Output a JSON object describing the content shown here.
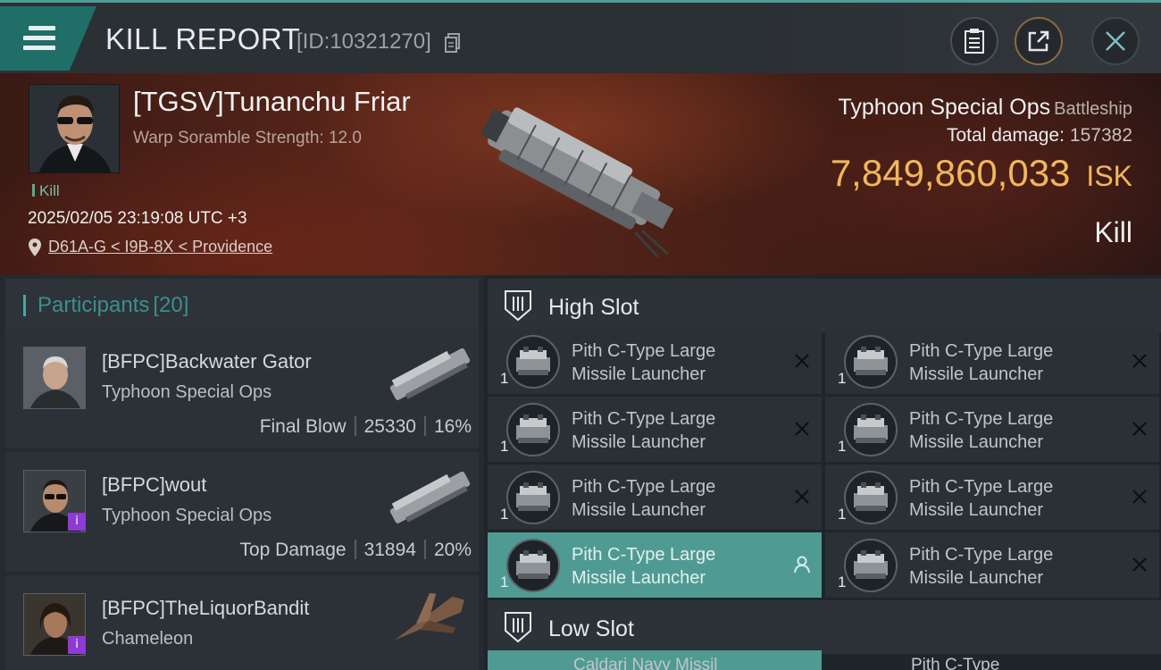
{
  "header": {
    "title": "KILL REPORT",
    "report_id": "[ID:10321270]",
    "icons": [
      "menu-icon",
      "copy-icon",
      "clipboard-icon",
      "share-icon",
      "close-icon"
    ]
  },
  "victim": {
    "name": "[TGSV]Tunanchu Friar",
    "scramble": "Warp Soramble Strength: 12.0",
    "kill_tag": "Kill",
    "datetime": "2025/02/05 23:19:08 UTC +3",
    "location": "D61A-G < I9B-8X < Providence",
    "ship_name": "Typhoon Special Ops",
    "ship_class": "Battleship",
    "total_damage_label": "Total damage:",
    "total_damage": "157382",
    "isk_value": "7,849,860,033",
    "isk_unit": "ISK",
    "result": "Kill"
  },
  "participants": {
    "label": "Participants",
    "count": "[20]",
    "rows": [
      {
        "name": "[BFPC]Backwater Gator",
        "ship": "Typhoon Special Ops",
        "stat_label": "Final Blow",
        "damage": "25330",
        "percent": "16%"
      },
      {
        "name": "[BFPC]wout",
        "ship": "Typhoon Special Ops",
        "stat_label": "Top Damage",
        "damage": "31894",
        "percent": "20%",
        "badge": "i"
      },
      {
        "name": "[BFPC]TheLiquorBandit",
        "ship": "Chameleon",
        "badge": "i"
      }
    ]
  },
  "fitting": {
    "high_slot": {
      "title": "High Slot",
      "modules": [
        {
          "line1": "Pith C-Type Large",
          "line2": "Missile Launcher",
          "qty": "1",
          "status": "destroyed"
        },
        {
          "line1": "Pith C-Type Large",
          "line2": "Missile Launcher",
          "qty": "1",
          "status": "destroyed"
        },
        {
          "line1": "Pith C-Type Large",
          "line2": "Missile Launcher",
          "qty": "1",
          "status": "destroyed"
        },
        {
          "line1": "Pith C-Type Large",
          "line2": "Missile Launcher",
          "qty": "1",
          "status": "destroyed"
        },
        {
          "line1": "Pith C-Type Large",
          "line2": "Missile Launcher",
          "qty": "1",
          "status": "destroyed"
        },
        {
          "line1": "Pith C-Type Large",
          "line2": "Missile Launcher",
          "qty": "1",
          "status": "destroyed"
        },
        {
          "line1": "Pith C-Type Large",
          "line2": "Missile Launcher",
          "qty": "1",
          "status": "dropped"
        },
        {
          "line1": "Pith C-Type Large",
          "line2": "Missile Launcher",
          "qty": "1",
          "status": "destroyed"
        }
      ]
    },
    "low_slot": {
      "title": "Low Slot",
      "partial_left": "Caldari Navy Missil",
      "partial_right": "Pith C-Type"
    }
  },
  "colors": {
    "accent": "#4f9b94",
    "isk": "#f0b75c",
    "teal_text": "#3d8f8c"
  }
}
